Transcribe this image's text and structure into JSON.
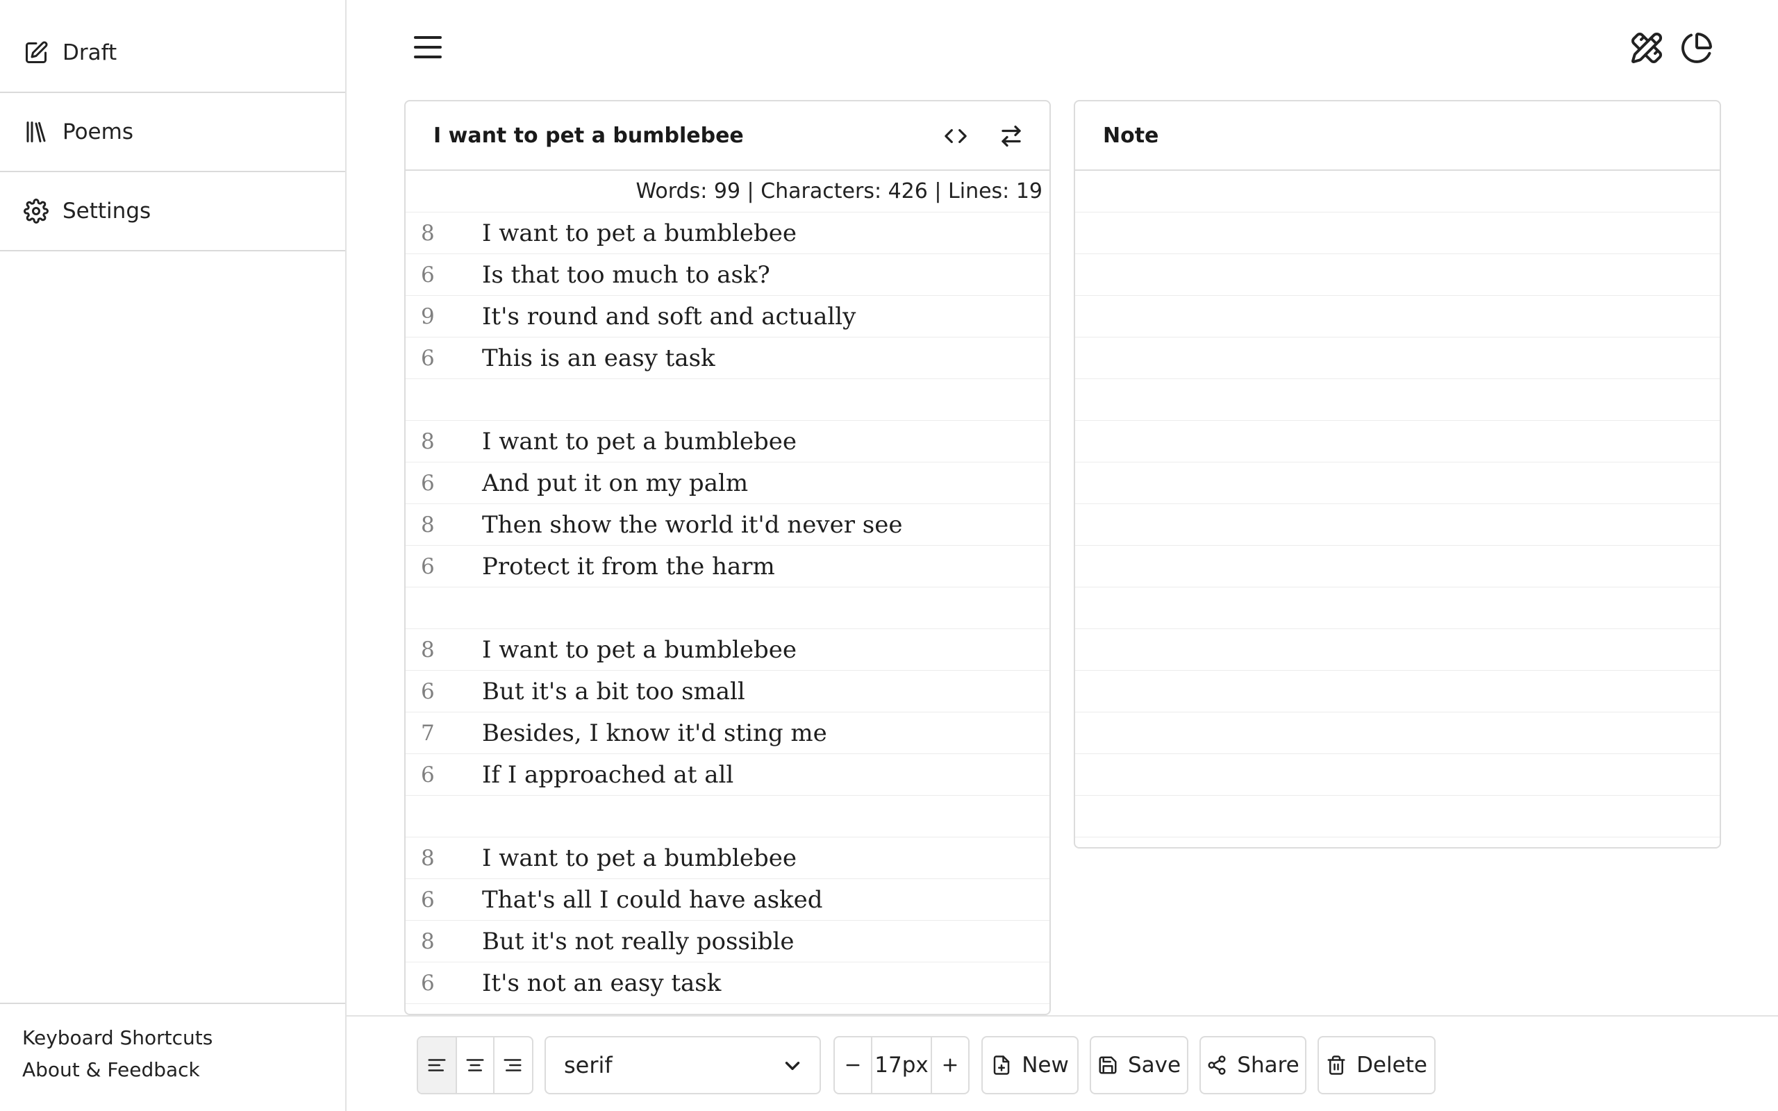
{
  "sidebar": {
    "items": [
      {
        "label": "Draft",
        "icon": "edit-icon"
      },
      {
        "label": "Poems",
        "icon": "library-icon"
      },
      {
        "label": "Settings",
        "icon": "gear-icon"
      }
    ],
    "footer": {
      "shortcuts": "Keyboard Shortcuts",
      "about": "About & Feedback"
    }
  },
  "poem": {
    "title": "I want to pet a bumblebee",
    "stats": "Words: 99 | Characters: 426 | Lines: 19",
    "lines": [
      {
        "count": "8",
        "text": "I want to pet a bumblebee"
      },
      {
        "count": "6",
        "text": "Is that too much to ask?"
      },
      {
        "count": "9",
        "text": "It's round and soft and actually"
      },
      {
        "count": "6",
        "text": "This is an easy task"
      },
      {
        "count": "",
        "text": ""
      },
      {
        "count": "8",
        "text": "I want to pet a bumblebee"
      },
      {
        "count": "6",
        "text": "And put it on my palm"
      },
      {
        "count": "8",
        "text": "Then show the world it'd never see"
      },
      {
        "count": "6",
        "text": "Protect it from the harm"
      },
      {
        "count": "",
        "text": ""
      },
      {
        "count": "8",
        "text": "I want to pet a bumblebee"
      },
      {
        "count": "6",
        "text": "But it's a bit too small"
      },
      {
        "count": "7",
        "text": "Besides, I know it'd sting me"
      },
      {
        "count": "6",
        "text": "If I approached at all"
      },
      {
        "count": "",
        "text": ""
      },
      {
        "count": "8",
        "text": "I want to pet a bumblebee"
      },
      {
        "count": "6",
        "text": "That's all I could have asked"
      },
      {
        "count": "8",
        "text": "But it's not really possible"
      },
      {
        "count": "6",
        "text": "It's not an easy task"
      }
    ]
  },
  "note": {
    "title": "Note"
  },
  "toolbar": {
    "font": "serif",
    "font_size": "17px",
    "new_label": "New",
    "save_label": "Save",
    "share_label": "Share",
    "delete_label": "Delete"
  },
  "colors": {
    "border": "#dcdcdc",
    "syllable": "#808080",
    "text": "#1e1e1e"
  }
}
